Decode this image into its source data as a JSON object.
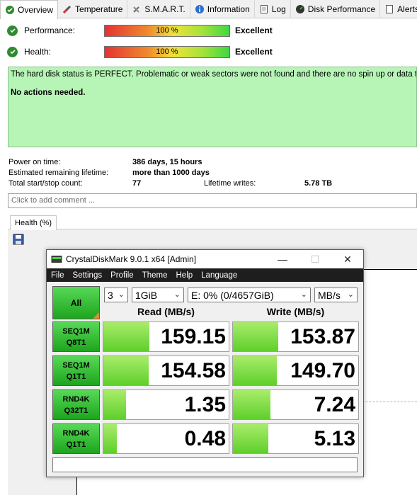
{
  "tabs": [
    {
      "label": "Overview",
      "icon": "globe-check-icon"
    },
    {
      "label": "Temperature",
      "icon": "thermometer-icon"
    },
    {
      "label": "S.M.A.R.T.",
      "icon": "tools-icon"
    },
    {
      "label": "Information",
      "icon": "info-icon"
    },
    {
      "label": "Log",
      "icon": "document-icon"
    },
    {
      "label": "Disk Performance",
      "icon": "gauge-icon"
    },
    {
      "label": "Alerts",
      "icon": "page-icon"
    }
  ],
  "performance": {
    "label": "Performance:",
    "percent": "100 %",
    "value": "Excellent",
    "fill": 1.0
  },
  "health": {
    "label": "Health:",
    "percent": "100 %",
    "value": "Excellent",
    "fill": 1.0
  },
  "status_message": "The hard disk status is PERFECT. Problematic or weak sectors were not found and there are no spin up or data t",
  "actions": "No actions needed.",
  "stats": {
    "power_on_label": "Power on time:",
    "power_on_value": "386 days, 15 hours",
    "lifetime_label": "Estimated remaining lifetime:",
    "lifetime_value": "more than 1000 days",
    "startstop_label": "Total start/stop count:",
    "startstop_value": "77",
    "writes_label": "Lifetime writes:",
    "writes_value": "5.78 TB"
  },
  "comment_placeholder": "Click to add comment ...",
  "health_tab": "Health (%)",
  "cdm": {
    "title": "CrystalDiskMark 9.0.1 x64 [Admin]",
    "menu": [
      "File",
      "Settings",
      "Profile",
      "Theme",
      "Help",
      "Language"
    ],
    "all_label": "All",
    "count": "3",
    "size": "1GiB",
    "drive": "E: 0% (0/4657GiB)",
    "unit": "MB/s",
    "read_header": "Read (MB/s)",
    "write_header": "Write (MB/s)",
    "rows": [
      {
        "line1": "SEQ1M",
        "line2": "Q8T1",
        "read": "159.15",
        "write": "153.87",
        "read_fill": 0.37,
        "write_fill": 0.36
      },
      {
        "line1": "SEQ1M",
        "line2": "Q1T1",
        "read": "154.58",
        "write": "149.70",
        "read_fill": 0.36,
        "write_fill": 0.35
      },
      {
        "line1": "RND4K",
        "line2": "Q32T1",
        "read": "1.35",
        "write": "7.24",
        "read_fill": 0.18,
        "write_fill": 0.3
      },
      {
        "line1": "RND4K",
        "line2": "Q1T1",
        "read": "0.48",
        "write": "5.13",
        "read_fill": 0.11,
        "write_fill": 0.28
      }
    ]
  }
}
